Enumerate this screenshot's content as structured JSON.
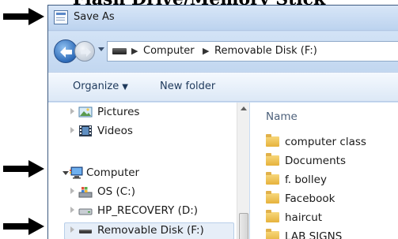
{
  "doc_heading": "Flash Drive/Memory Stick",
  "window": {
    "title": "Save As",
    "address": {
      "breadcrumbs": [
        "Computer",
        "Removable Disk (F:)"
      ]
    },
    "toolbar": {
      "organize_label": "Organize",
      "new_folder_label": "New folder"
    },
    "nav_tree": [
      {
        "label": "Pictures",
        "icon": "pictures-library-icon",
        "expanded": false
      },
      {
        "label": "Videos",
        "icon": "videos-library-icon",
        "expanded": false
      },
      {
        "label": "Computer",
        "icon": "computer-icon",
        "expanded": true
      },
      {
        "label": "OS (C:)",
        "icon": "system-drive-icon",
        "expanded": false
      },
      {
        "label": "HP_RECOVERY (D:)",
        "icon": "hard-drive-icon",
        "expanded": false
      },
      {
        "label": "Removable Disk (F:)",
        "icon": "removable-drive-icon",
        "expanded": false,
        "selected": true
      }
    ],
    "file_list": {
      "column_header": "Name",
      "folders": [
        "computer class",
        "Documents",
        "f. bolley",
        "Facebook",
        "haircut",
        "LAB SIGNS"
      ]
    }
  },
  "annotation_arrows": [
    "title-bar",
    "computer-node",
    "removable-disk-node"
  ],
  "colors": {
    "title_bar": "#c9dcf3",
    "selection_highlight": "#e6eef8",
    "folder": "#e6b23c"
  }
}
